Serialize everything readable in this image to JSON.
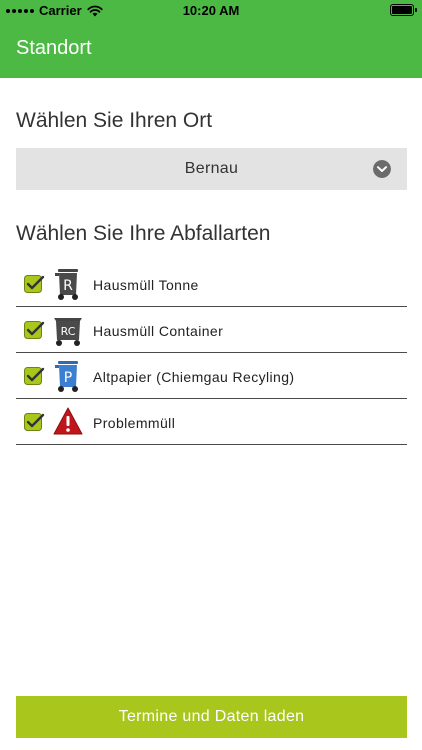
{
  "status_bar": {
    "carrier": "Carrier",
    "time": "10:20 AM"
  },
  "nav": {
    "title": "Standort"
  },
  "location": {
    "heading": "Wählen Sie Ihren Ort",
    "selected": "Bernau"
  },
  "waste": {
    "heading": "Wählen Sie Ihre Abfallarten",
    "items": [
      {
        "label": "Hausmüll Tonne",
        "icon": "residual-waste-bin-icon",
        "bin_letter": "R",
        "checked": true
      },
      {
        "label": "Hausmüll Container",
        "icon": "residual-waste-container-icon",
        "bin_letter": "RC",
        "checked": true
      },
      {
        "label": "Altpapier (Chiemgau Recyling)",
        "icon": "paper-bin-icon",
        "bin_letter": "P",
        "checked": true
      },
      {
        "label": "Problemmüll",
        "icon": "hazard-warning-icon",
        "checked": true
      }
    ]
  },
  "actions": {
    "load_label": "Termine und Daten laden"
  },
  "colors": {
    "header": "#4cb944",
    "accent": "#a8c61c",
    "checkbox": "#a8c61c",
    "dropdown_bg": "#e3e3e3"
  }
}
